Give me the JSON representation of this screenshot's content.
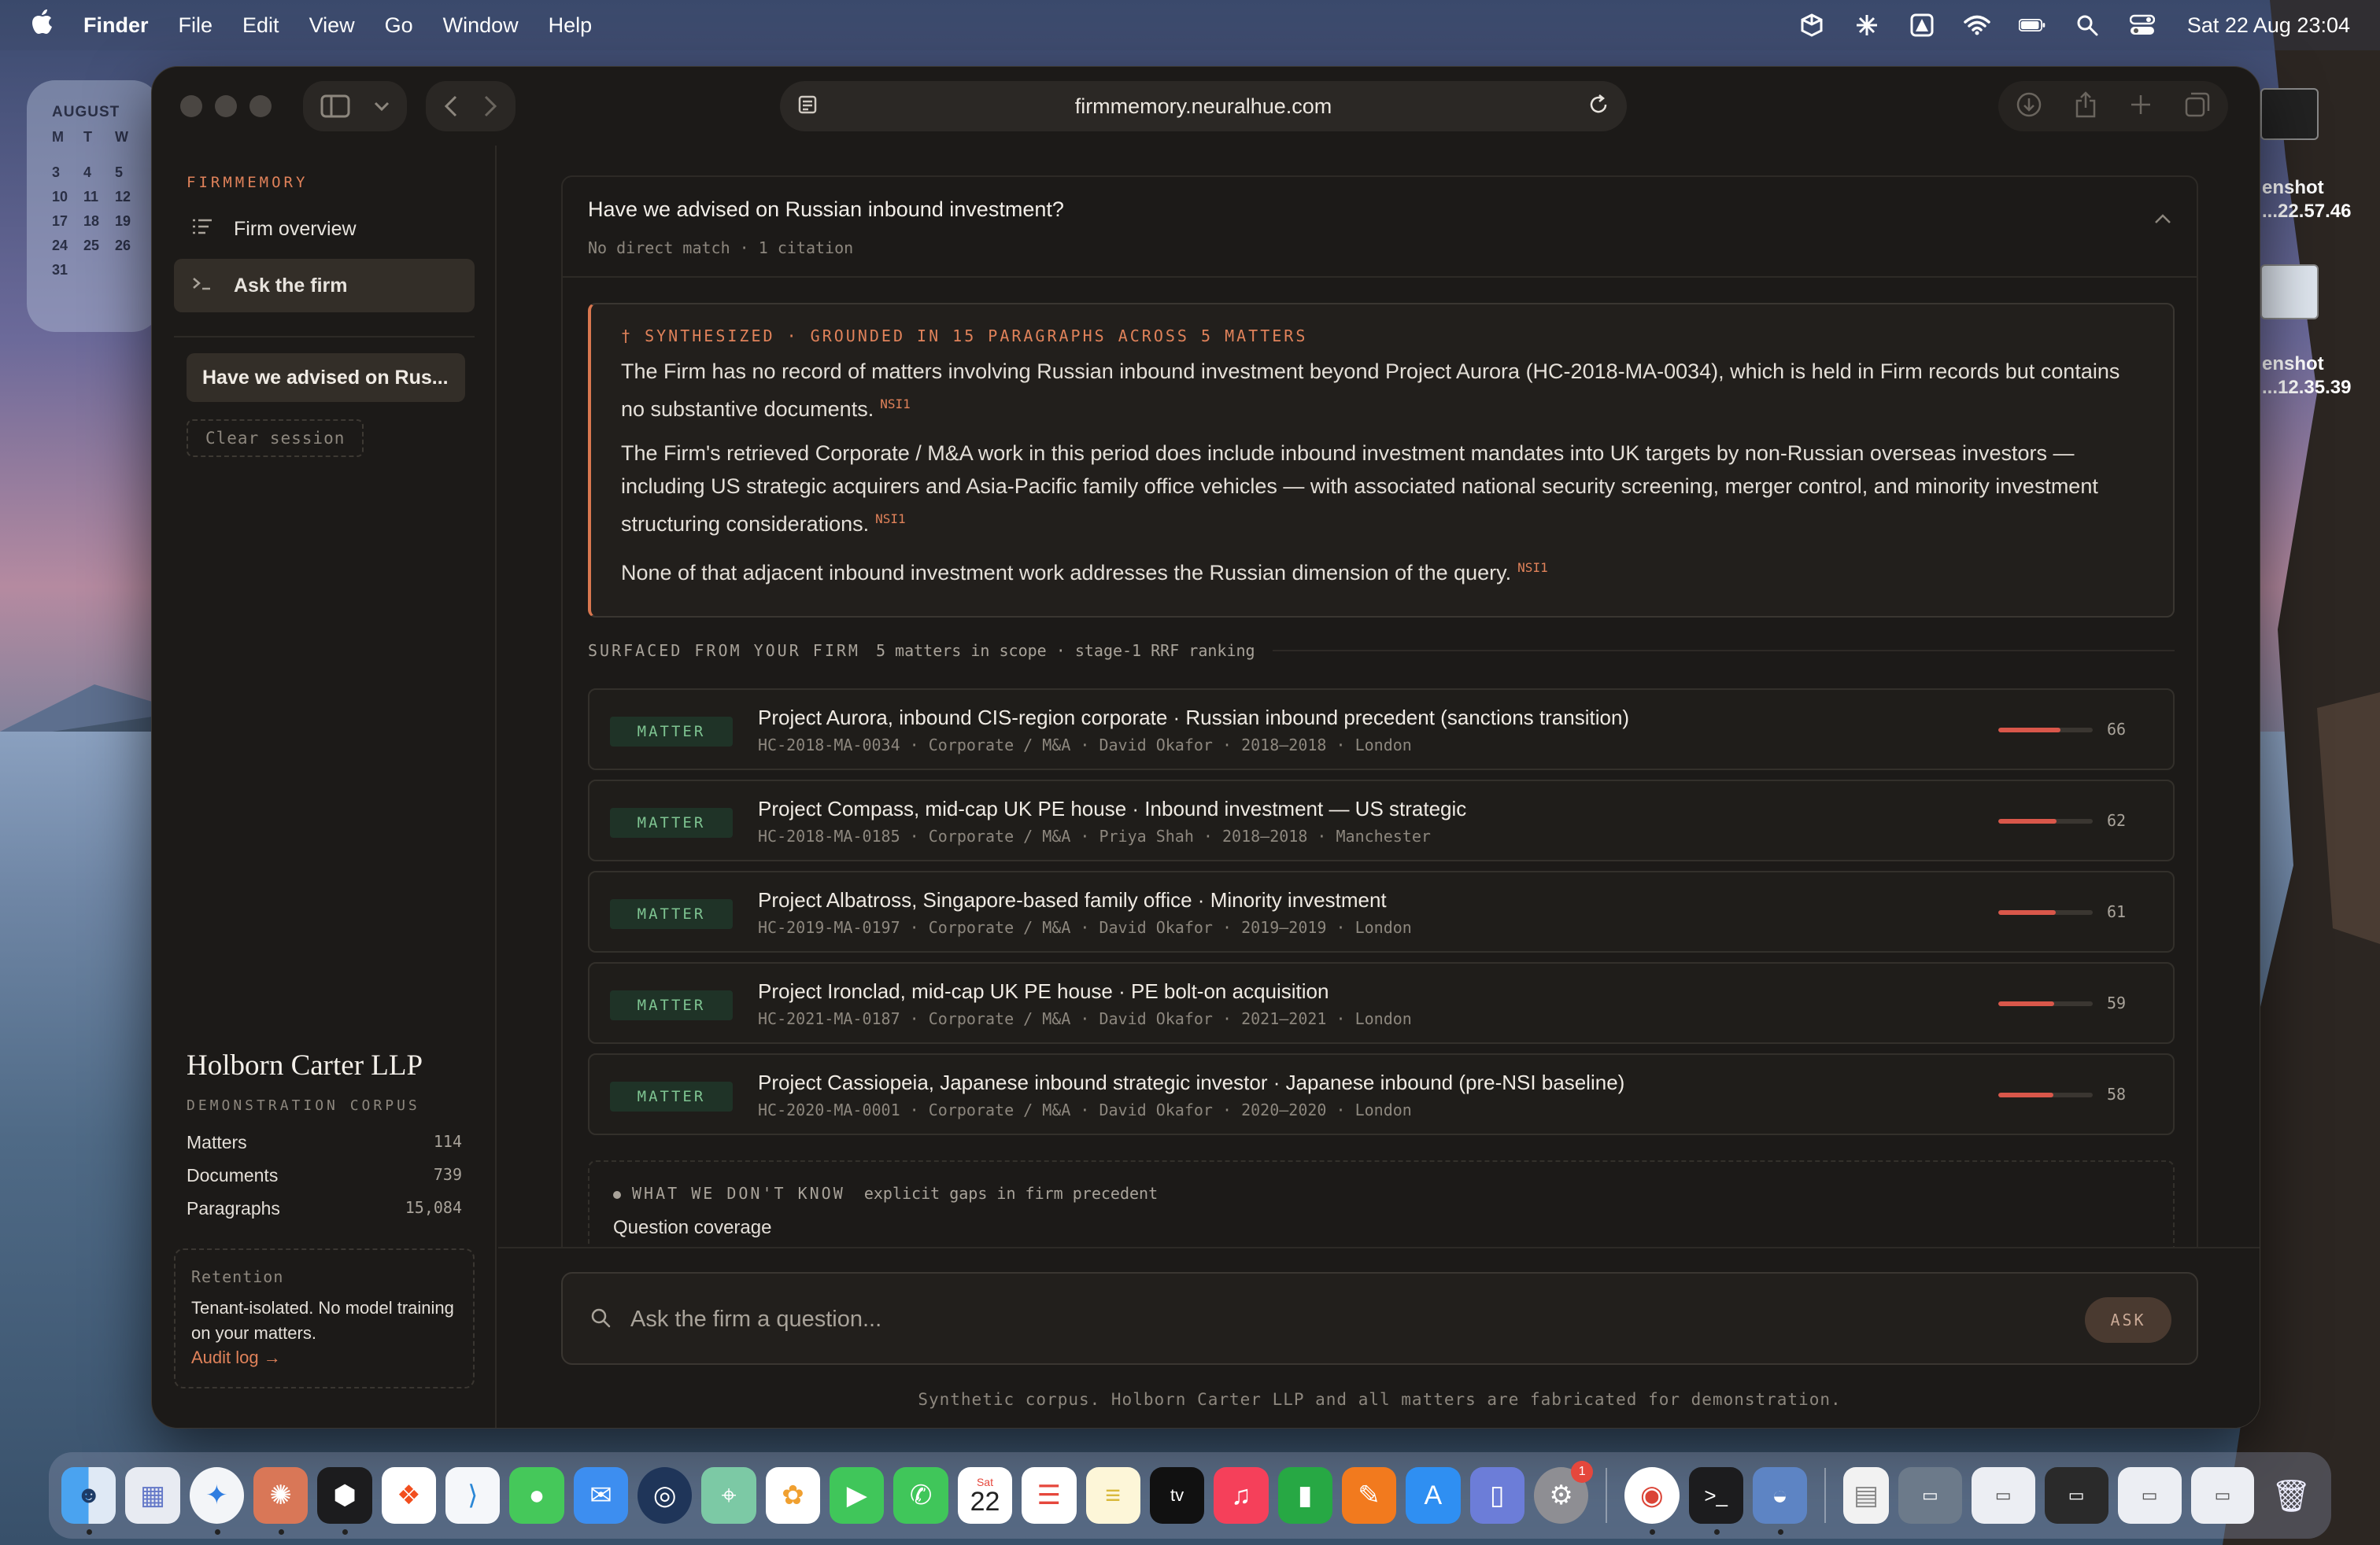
{
  "menubar": {
    "app_name": "Finder",
    "items": [
      "File",
      "Edit",
      "View",
      "Go",
      "Window",
      "Help"
    ],
    "clock": "Sat 22 Aug  23:04"
  },
  "calendar": {
    "month": "AUGUST",
    "weekday_headers": [
      "M",
      "T",
      "W"
    ],
    "rows": [
      [
        "3",
        "4",
        "5"
      ],
      [
        "10",
        "11",
        "12"
      ],
      [
        "17",
        "18",
        "19"
      ],
      [
        "24",
        "25",
        "26"
      ],
      [
        "31"
      ]
    ]
  },
  "desktop": {
    "file1_label_a": "enshot",
    "file1_label_b": "...22.57.46",
    "file2_label_a": "enshot",
    "file2_label_b": "...12.35.39"
  },
  "browser": {
    "url": "firmmemory.neuralhue.com"
  },
  "sidebar": {
    "brand": "FIRMMEMORY",
    "nav": [
      {
        "label": "Firm overview",
        "icon": "list-icon"
      },
      {
        "label": "Ask the firm",
        "icon": "terminal-prompt-icon"
      }
    ],
    "session": "Have we advised on Rus...",
    "clear_session": "Clear session",
    "firm_name": "Holborn Carter LLP",
    "corpus_label": "DEMONSTRATION CORPUS",
    "stats": [
      {
        "label": "Matters",
        "value": "114"
      },
      {
        "label": "Documents",
        "value": "739"
      },
      {
        "label": "Paragraphs",
        "value": "15,084"
      }
    ],
    "retention": {
      "title": "Retention",
      "text": "Tenant-isolated. No model training on your matters.",
      "link": "Audit log →"
    }
  },
  "question": {
    "title": "Have we advised on Russian inbound investment?",
    "subtitle": "No direct match · 1 citation"
  },
  "answer": {
    "tag": "† SYNTHESIZED · GROUNDED IN 15 PARAGRAPHS ACROSS 5 MATTERS",
    "paragraphs": [
      {
        "text": "The Firm has no record of matters involving Russian inbound investment beyond Project Aurora (HC-2018-MA-0034), which is held in Firm records but contains no substantive documents.",
        "cite": "NSI1"
      },
      {
        "text": "The Firm's retrieved Corporate / M&A work in this period does include inbound investment mandates into UK targets by non-Russian overseas investors — including US strategic acquirers and Asia-Pacific family office vehicles — with associated national security screening, merger control, and minority investment structuring considerations.",
        "cite": "NSI1"
      },
      {
        "text": "None of that adjacent inbound investment work addresses the Russian dimension of the query.",
        "cite": "NSI1"
      }
    ]
  },
  "surfaced": {
    "label": "SURFACED FROM YOUR FIRM",
    "meta": "5 matters in scope · stage-1 RRF ranking"
  },
  "matters": [
    {
      "badge": "MATTER",
      "title": "Project Aurora, inbound CIS-region corporate · Russian inbound precedent (sanctions transition)",
      "meta": "HC-2018-MA-0034 · Corporate / M&A · David Okafor · 2018–2018 · London",
      "score": 66
    },
    {
      "badge": "MATTER",
      "title": "Project Compass, mid-cap UK PE house · Inbound investment — US strategic",
      "meta": "HC-2018-MA-0185 · Corporate / M&A · Priya Shah · 2018–2018 · Manchester",
      "score": 62
    },
    {
      "badge": "MATTER",
      "title": "Project Albatross, Singapore-based family office · Minority investment",
      "meta": "HC-2019-MA-0197 · Corporate / M&A · David Okafor · 2019–2019 · London",
      "score": 61
    },
    {
      "badge": "MATTER",
      "title": "Project Ironclad, mid-cap UK PE house · PE bolt-on acquisition",
      "meta": "HC-2021-MA-0187 · Corporate / M&A · David Okafor · 2021–2021 · London",
      "score": 59
    },
    {
      "badge": "MATTER",
      "title": "Project Cassiopeia, Japanese inbound strategic investor · Japanese inbound (pre-NSI baseline)",
      "meta": "HC-2020-MA-0001 · Corporate / M&A · David Okafor · 2020–2020 · London",
      "score": 58
    }
  ],
  "gaps": {
    "label": "WHAT WE DON'T KNOW",
    "meta": "explicit gaps in firm precedent",
    "sub": "Question coverage"
  },
  "composer": {
    "placeholder": "Ask the firm a question...",
    "ask_label": "ASK"
  },
  "footer": "Synthetic corpus. Holborn Carter LLP and all matters are fabricated for demonstration.",
  "dock": {
    "calendar_day": "22",
    "calendar_weekday": "Sat",
    "settings_badge": "1"
  }
}
